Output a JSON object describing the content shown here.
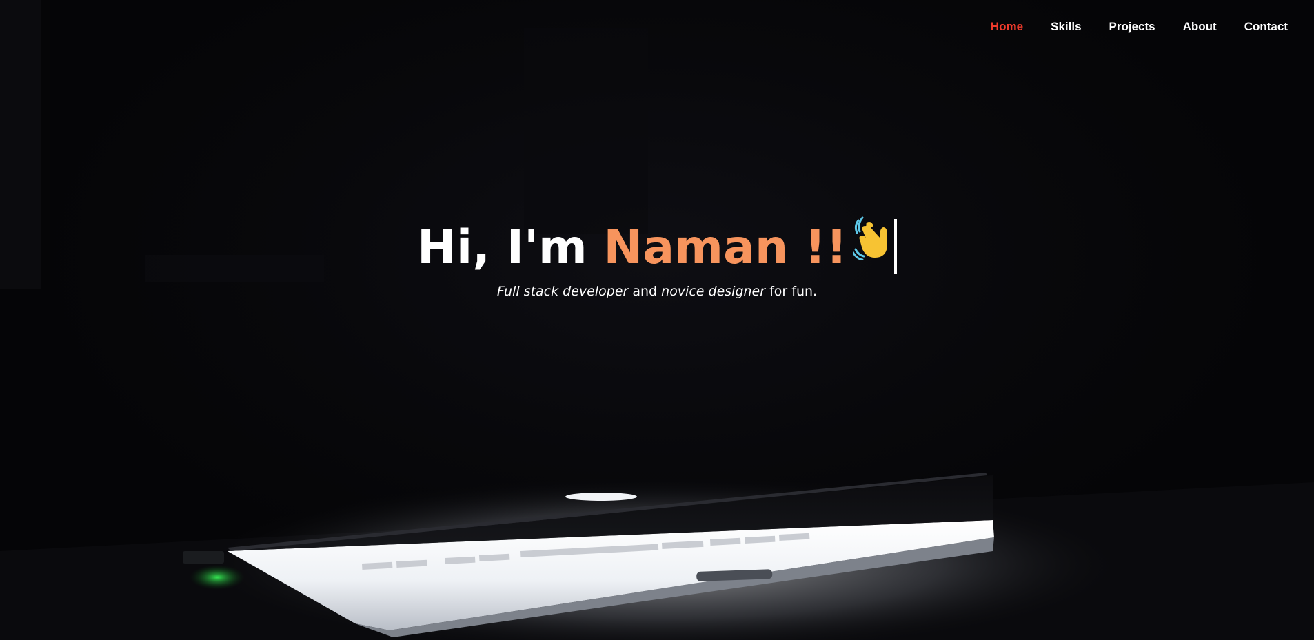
{
  "nav": {
    "items": [
      {
        "label": "Home",
        "active": true
      },
      {
        "label": "Skills",
        "active": false
      },
      {
        "label": "Projects",
        "active": false
      },
      {
        "label": "About",
        "active": false
      },
      {
        "label": "Contact",
        "active": false
      }
    ]
  },
  "hero": {
    "greeting_prefix": "Hi, I'm ",
    "name": "Naman !!",
    "emoji_icon": "waving-hand-icon",
    "subtitle": {
      "role1": "Full stack developer",
      "connector": " and ",
      "role2": "novice designer",
      "suffix": " for fun."
    },
    "background_icon": "laptop-glow-image"
  },
  "colors": {
    "accent_active": "#ef3b2c",
    "name_accent": "#f7945d",
    "background": "#07070a",
    "text": "#ffffff"
  }
}
